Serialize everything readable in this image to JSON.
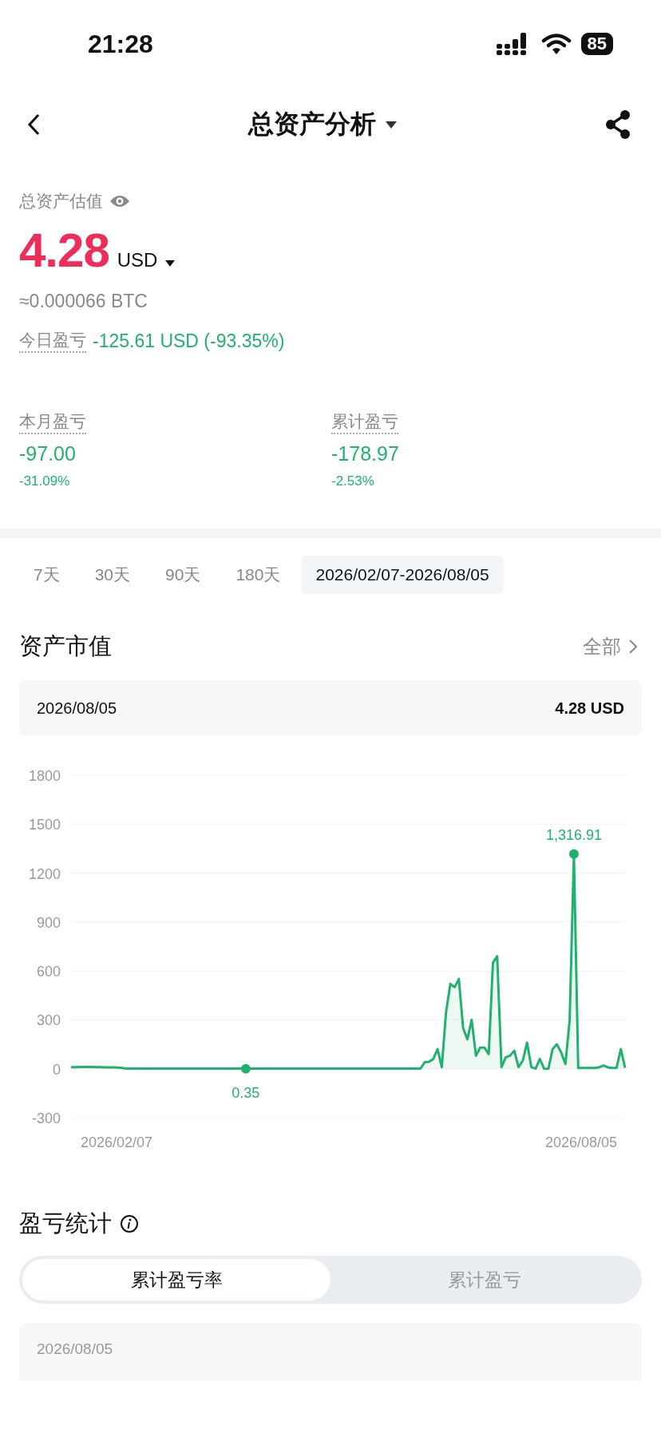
{
  "status_bar": {
    "time": "21:28",
    "battery": "85"
  },
  "nav": {
    "title": "总资产分析"
  },
  "summary": {
    "label": "总资产估值",
    "amount": "4.28",
    "currency": "USD",
    "btc": "≈0.000066 BTC",
    "today_label": "今日盈亏",
    "today_value": "-125.61 USD (-93.35%)"
  },
  "stats": [
    {
      "label": "本月盈亏",
      "value": "-97.00",
      "percent": "-31.09%"
    },
    {
      "label": "累计盈亏",
      "value": "-178.97",
      "percent": "-2.53%"
    }
  ],
  "range_tabs": [
    {
      "label": "7天",
      "selected": false
    },
    {
      "label": "30天",
      "selected": false
    },
    {
      "label": "90天",
      "selected": false
    },
    {
      "label": "180天",
      "selected": false
    },
    {
      "label": "2026/02/07-2026/08/05",
      "selected": true
    }
  ],
  "asset_value": {
    "title": "资产市值",
    "more": "全部",
    "tooltip_date": "2026/08/05",
    "tooltip_value": "4.28 USD",
    "x_labels": [
      "2026/02/07",
      "2026/08/05"
    ],
    "point_labels": [
      "0.35",
      "1,316.91"
    ],
    "chart_data": {
      "type": "area",
      "ylim": [
        -300,
        1800
      ],
      "yticks": [
        -300,
        0,
        300,
        600,
        900,
        1200,
        1500,
        1800
      ],
      "grid": true,
      "series": [
        {
          "color": "#20b26c",
          "values": [
            10,
            10,
            11,
            11,
            11,
            11,
            10,
            10,
            9,
            8,
            8,
            7,
            5,
            1,
            1,
            1,
            1,
            1,
            1,
            1,
            1,
            1,
            1,
            1,
            1,
            1,
            1,
            1,
            1,
            1,
            1,
            1,
            1,
            1,
            1,
            1,
            1,
            1,
            1,
            1,
            1,
            0,
            1,
            1,
            1,
            1,
            1,
            1,
            1,
            1,
            1,
            1,
            1,
            1,
            1,
            1,
            1,
            1,
            1,
            1,
            1,
            1,
            1,
            1,
            1,
            1,
            1,
            1,
            1,
            1,
            1,
            1,
            1,
            1,
            1,
            1,
            1,
            1,
            1,
            1,
            1,
            1,
            1,
            40,
            42,
            60,
            120,
            10,
            350,
            520,
            500,
            550,
            250,
            180,
            300,
            80,
            130,
            130,
            90,
            650,
            690,
            10,
            70,
            80,
            110,
            10,
            50,
            160,
            10,
            0,
            60,
            0,
            0,
            120,
            150,
            100,
            30,
            300,
            1317,
            5,
            5,
            5,
            5,
            5,
            10,
            20,
            8,
            5,
            5,
            120,
            5
          ]
        }
      ]
    }
  },
  "pnl_stats": {
    "title": "盈亏统计",
    "segments": [
      {
        "label": "累计盈亏率",
        "selected": true
      },
      {
        "label": "累计盈亏",
        "selected": false
      }
    ],
    "card_date": "2026/08/05"
  }
}
